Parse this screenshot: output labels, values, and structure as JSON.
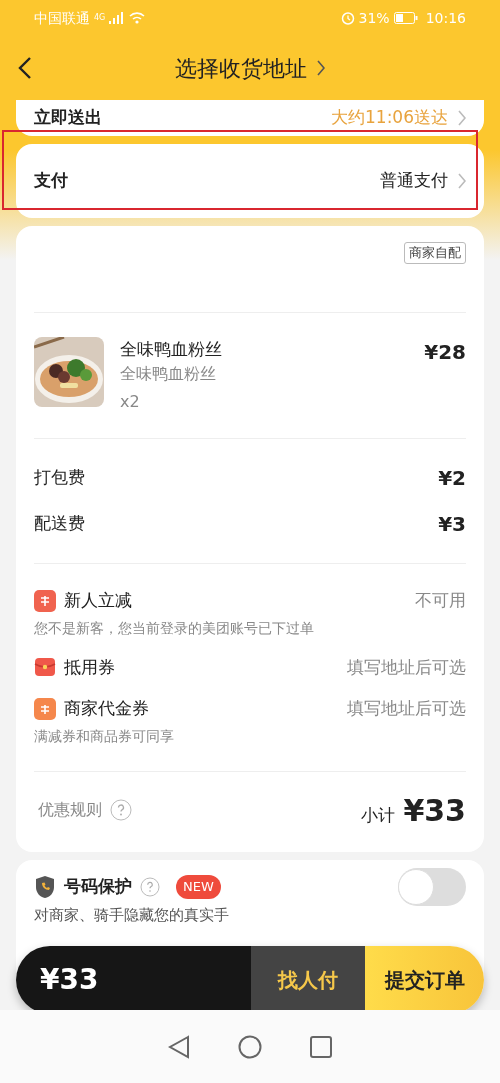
{
  "status_bar": {
    "carrier": "中国联通",
    "network": "4G",
    "battery": "31%",
    "time": "10:16"
  },
  "header": {
    "title": "选择收货地址"
  },
  "delivery": {
    "label": "立即送出",
    "value": "大约11:06送达"
  },
  "payment": {
    "label": "支付",
    "value": "普通支付",
    "highlighted": true
  },
  "order": {
    "delivery_tag": "商家自配",
    "items": [
      {
        "name": "全味鸭血粉丝",
        "spec": "全味鸭血粉丝",
        "quantity": "x2",
        "price": "¥28"
      }
    ],
    "fees": [
      {
        "label": "打包费",
        "amount": "¥2"
      },
      {
        "label": "配送费",
        "amount": "¥3"
      }
    ],
    "discounts": [
      {
        "kind": "new",
        "label": "新人立减",
        "value": "不可用",
        "note": "您不是新客，您当前登录的美团账号已下过单"
      },
      {
        "kind": "redpacket",
        "label": "抵用券",
        "value": "填写地址后可选"
      },
      {
        "kind": "voucher",
        "label": "商家代金券",
        "value": "填写地址后可选",
        "note": "满减券和商品券可同享"
      }
    ],
    "rules_label": "优惠规则",
    "subtotal_label": "小计",
    "subtotal": "¥33"
  },
  "privacy": {
    "label": "号码保护",
    "badge": "NEW",
    "on": false,
    "note": "对商家、骑手隐藏您的真实手"
  },
  "checkout": {
    "total": "¥33",
    "pay_by_other": "找人付",
    "submit": "提交订单"
  }
}
